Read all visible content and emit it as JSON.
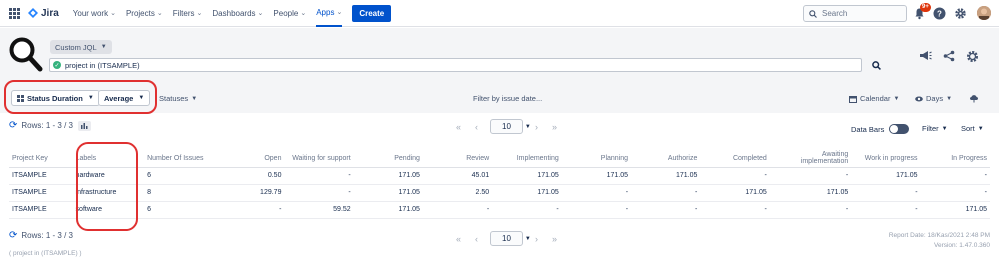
{
  "nav": {
    "logo": "Jira",
    "items": [
      {
        "label": "Your work",
        "chev": "⌄"
      },
      {
        "label": "Projects",
        "chev": "⌄"
      },
      {
        "label": "Filters",
        "chev": "⌄"
      },
      {
        "label": "Dashboards",
        "chev": "⌄"
      },
      {
        "label": "People",
        "chev": "⌄"
      },
      {
        "label": "Apps",
        "chev": "⌄"
      }
    ],
    "create_label": "Create",
    "search_placeholder": "Search",
    "notifications_badge": "9+"
  },
  "query": {
    "mode_label": "Custom JQL",
    "jql": "project in (ITSAMPLE)"
  },
  "controls": {
    "status_duration": "Status Duration",
    "average": "Average",
    "statuses": "Statuses",
    "filter_date": "Filter by issue date...",
    "calendar": "Calendar",
    "days": "Days"
  },
  "rows_info": "Rows: 1 - 3 / 3",
  "pager": {
    "page_size": "10",
    "first": "«",
    "prev": "‹",
    "next": "›",
    "last": "»"
  },
  "data_bars_label": "Data Bars",
  "filter_label": "Filter",
  "sort_label": "Sort",
  "table": {
    "headers": [
      "Project Key",
      "Labels",
      "Number Of Issues",
      "Open",
      "Waiting for support",
      "Pending",
      "Review",
      "Implementing",
      "Planning",
      "Authorize",
      "Completed",
      "Awaiting implementation",
      "Work in progress",
      "In Progress"
    ],
    "rows": [
      [
        "ITSAMPLE",
        "hardware",
        "6",
        "0.50",
        "-",
        "171.05",
        "45.01",
        "171.05",
        "171.05",
        "171.05",
        "-",
        "-",
        "171.05",
        "-"
      ],
      [
        "ITSAMPLE",
        "infrastructure",
        "8",
        "129.79",
        "-",
        "171.05",
        "2.50",
        "171.05",
        "-",
        "-",
        "171.05",
        "171.05",
        "-",
        "-"
      ],
      [
        "ITSAMPLE",
        "software",
        "6",
        "-",
        "59.52",
        "171.05",
        "-",
        "-",
        "-",
        "-",
        "-",
        "-",
        "-",
        "171.05"
      ]
    ]
  },
  "report_date": "Report Date: 18/Kas/2021 2:48 PM",
  "version": "Version: 1.47.0.360",
  "footer_jql": "( project in (ITSAMPLE) )",
  "colors": {
    "accent": "#0052cc",
    "highlight": "#e03030"
  }
}
